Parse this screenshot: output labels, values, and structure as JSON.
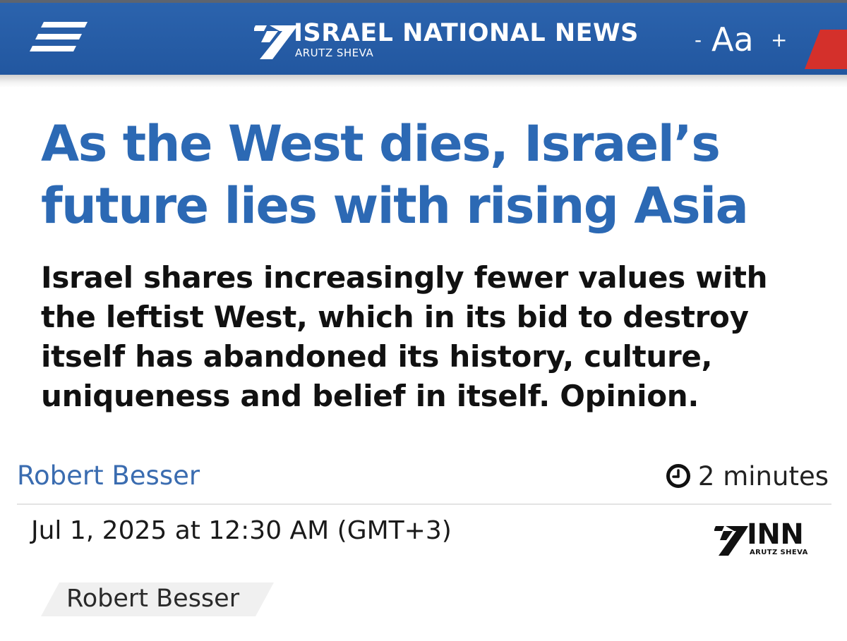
{
  "header": {
    "brand_name": "ISRAEL NATIONAL NEWS",
    "brand_sub": "ARUTZ SHEVA",
    "font_decrease": "-",
    "font_label": "Aa",
    "font_increase": "+",
    "menu_icon": "hamburger-menu-icon",
    "logo_icon": "inn-7-logo-icon"
  },
  "article": {
    "headline": "As the West dies, Israel’s future lies with rising Asia",
    "subtitle": "Israel shares increasingly fewer values with the leftist West, which in its bid to destroy itself has abandoned its history, culture, uniqueness and belief in itself. Opinion.",
    "author": "Robert Besser",
    "read_time": "2 minutes",
    "read_time_icon": "clock-icon",
    "date": "Jul 1, 2025 at 12:30 AM (GMT+3)",
    "author_tag": "Robert Besser"
  },
  "inn_logo": {
    "text": "INN",
    "sub": "ARUTZ SHEVA"
  },
  "colors": {
    "header_blue": "#2257a0",
    "headline_blue": "#2c69b4",
    "author_blue": "#3a6cb0",
    "accent_red": "#d4302b"
  }
}
